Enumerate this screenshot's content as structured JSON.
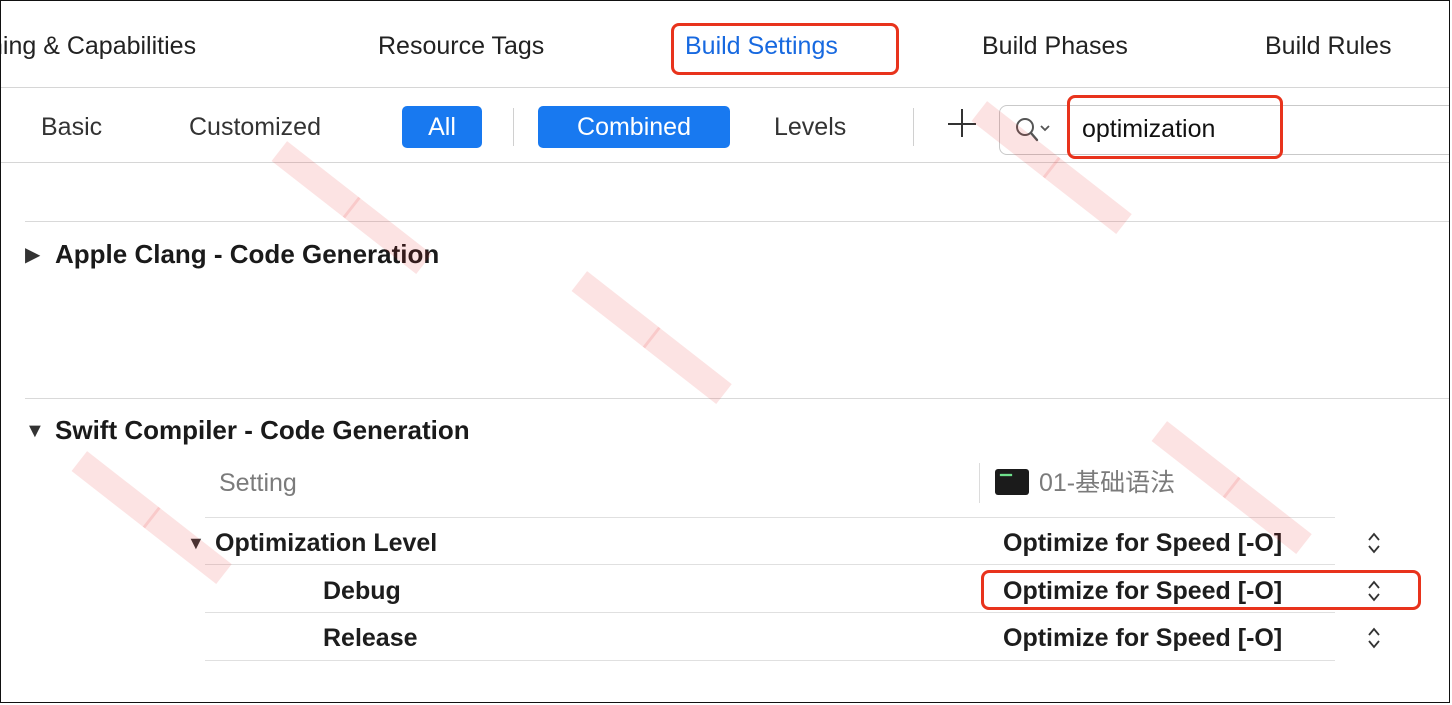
{
  "tabs": [
    {
      "label": "ning & Capabilities",
      "active": false
    },
    {
      "label": "Resource Tags",
      "active": false
    },
    {
      "label": "Build Settings",
      "active": true
    },
    {
      "label": "Build Phases",
      "active": false
    },
    {
      "label": "Build Rules",
      "active": false
    }
  ],
  "filter": {
    "basic": "Basic",
    "customized": "Customized",
    "all": "All",
    "combined": "Combined",
    "levels": "Levels"
  },
  "search": {
    "value": "optimization",
    "icon": "magnifier-dropdown-icon"
  },
  "sections": {
    "clang": {
      "title": "Apple Clang - Code Generation",
      "expanded": false
    },
    "swift": {
      "title": "Swift Compiler - Code Generation",
      "expanded": true
    }
  },
  "table": {
    "setting_header": "Setting",
    "target_header": "01-基础语法",
    "rows": [
      {
        "label": "Optimization Level",
        "value": "Optimize for Speed [-O]"
      },
      {
        "label": "Debug",
        "value": "Optimize for Speed [-O]"
      },
      {
        "label": "Release",
        "value": "Optimize for Speed [-O]"
      }
    ]
  },
  "colors": {
    "accent": "#1879f0",
    "highlight": "#e8331c"
  }
}
